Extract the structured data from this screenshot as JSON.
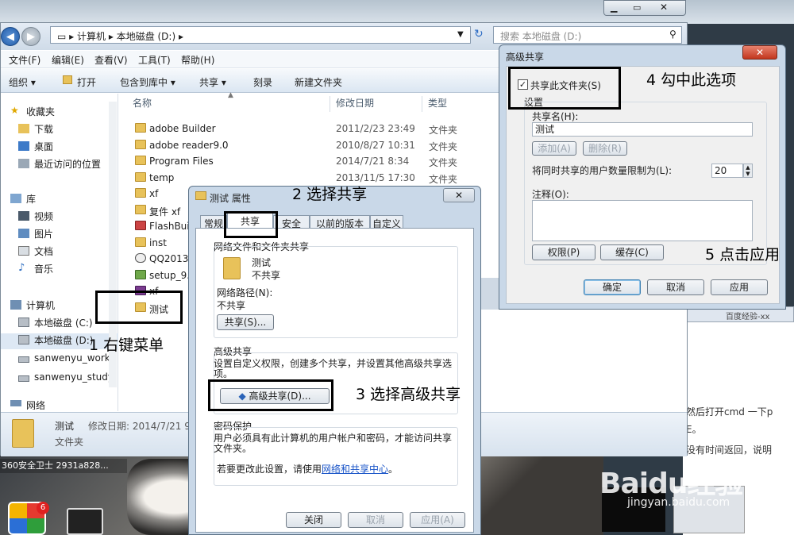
{
  "explorer": {
    "address": [
      "计算机",
      "本地磁盘 (D:)"
    ],
    "search_placeholder": "搜索 本地磁盘 (D:)",
    "menu": [
      "文件(F)",
      "编辑(E)",
      "查看(V)",
      "工具(T)",
      "帮助(H)"
    ],
    "toolbar": [
      "组织 ▾",
      "打开",
      "包含到库中 ▾",
      "共享 ▾",
      "刻录",
      "新建文件夹"
    ],
    "sidebar": {
      "favorites_head": "收藏夹",
      "favorites": [
        "下载",
        "桌面",
        "最近访问的位置"
      ],
      "library_head": "库",
      "libraries": [
        "视频",
        "图片",
        "文档",
        "音乐"
      ],
      "computer_head": "计算机",
      "drives": [
        "本地磁盘 (C:)",
        "本地磁盘 (D:)",
        "sanwenyu_work",
        "sanwenyu_study"
      ],
      "network_head": "网络"
    },
    "columns": {
      "name": "名称",
      "date": "修改日期",
      "type": "类型"
    },
    "files": [
      {
        "name": "adobe Builder",
        "date": "2011/2/23 23:49",
        "type": "文件夹"
      },
      {
        "name": "adobe reader9.0",
        "date": "2010/8/27 10:31",
        "type": "文件夹"
      },
      {
        "name": "Program Files",
        "date": "2014/7/21 8:34",
        "type": "文件夹"
      },
      {
        "name": "temp",
        "date": "2013/11/5 17:30",
        "type": "文件夹"
      },
      {
        "name": "xf",
        "date": "",
        "type": ""
      },
      {
        "name": "复件 xf",
        "date": "",
        "type": ""
      },
      {
        "name": "FlashBuil",
        "date": "",
        "type": ""
      },
      {
        "name": "inst",
        "date": "",
        "type": ""
      },
      {
        "name": "QQ2013",
        "date": "",
        "type": ""
      },
      {
        "name": "setup_9..",
        "date": "",
        "type": ""
      },
      {
        "name": "xf",
        "date": "",
        "type": ""
      },
      {
        "name": "测试",
        "date": "",
        "type": ""
      }
    ],
    "details": {
      "name": "测试",
      "date_label": "修改日期: 2014/7/21 9:",
      "kind": "文件夹"
    }
  },
  "properties": {
    "title": "测试 属性",
    "close": "✕",
    "tabs": [
      "常规",
      "共享",
      "安全",
      "以前的版本",
      "自定义"
    ],
    "network_group": "网络文件和文件夹共享",
    "folder_name": "测试",
    "share_state": "不共享",
    "network_path_label": "网络路径(N):",
    "network_path_value": "不共享",
    "share_button": "共享(S)...",
    "advanced_group": "高级共享",
    "advanced_desc": "设置自定义权限，创建多个共享，并设置其他高级共享选项。",
    "advanced_button": "高级共享(D)...",
    "password_group": "密码保护",
    "password_desc": "用户必须具有此计算机的用户帐户和密码，才能访问共享文件夹。",
    "password_change": "若要更改此设置，请使用",
    "password_link": "网络和共享中心",
    "password_end": "。",
    "buttons": [
      "关闭",
      "取消",
      "应用(A)"
    ]
  },
  "advanced": {
    "title": "高级共享",
    "close": "✕",
    "share_checkbox": "共享此文件夹(S)",
    "share_checked": true,
    "settings": "设置",
    "share_name_label": "共享名(H):",
    "share_name_value": "测试",
    "add_button": "添加(A)",
    "remove_button": "删除(R)",
    "limit_label": "将同时共享的用户数量限制为(L):",
    "limit_value": "20",
    "comment_label": "注释(O):",
    "permissions_button": "权限(P)",
    "cache_button": "缓存(C)",
    "ok": "确定",
    "cancel": "取消",
    "apply": "应用"
  },
  "annotations": {
    "step1": "1 右键菜单",
    "step2": "2 选择共享",
    "step3": "3 选择高级共享",
    "step4": "4 勾中此选项",
    "step5": "5 点击应用"
  },
  "background": {
    "taskbar_label": "360安全卫士 2931a828...",
    "badge": "6",
    "browser_tab": "百度经验-xx",
    "browser_line1": "然后打开cmd 一下p",
    "browser_line2": "E。",
    "browser_line3": "没有时间返回，说明",
    "watermark": "Baidu经验",
    "watermark_sub": "jingyan.baidu.com"
  }
}
